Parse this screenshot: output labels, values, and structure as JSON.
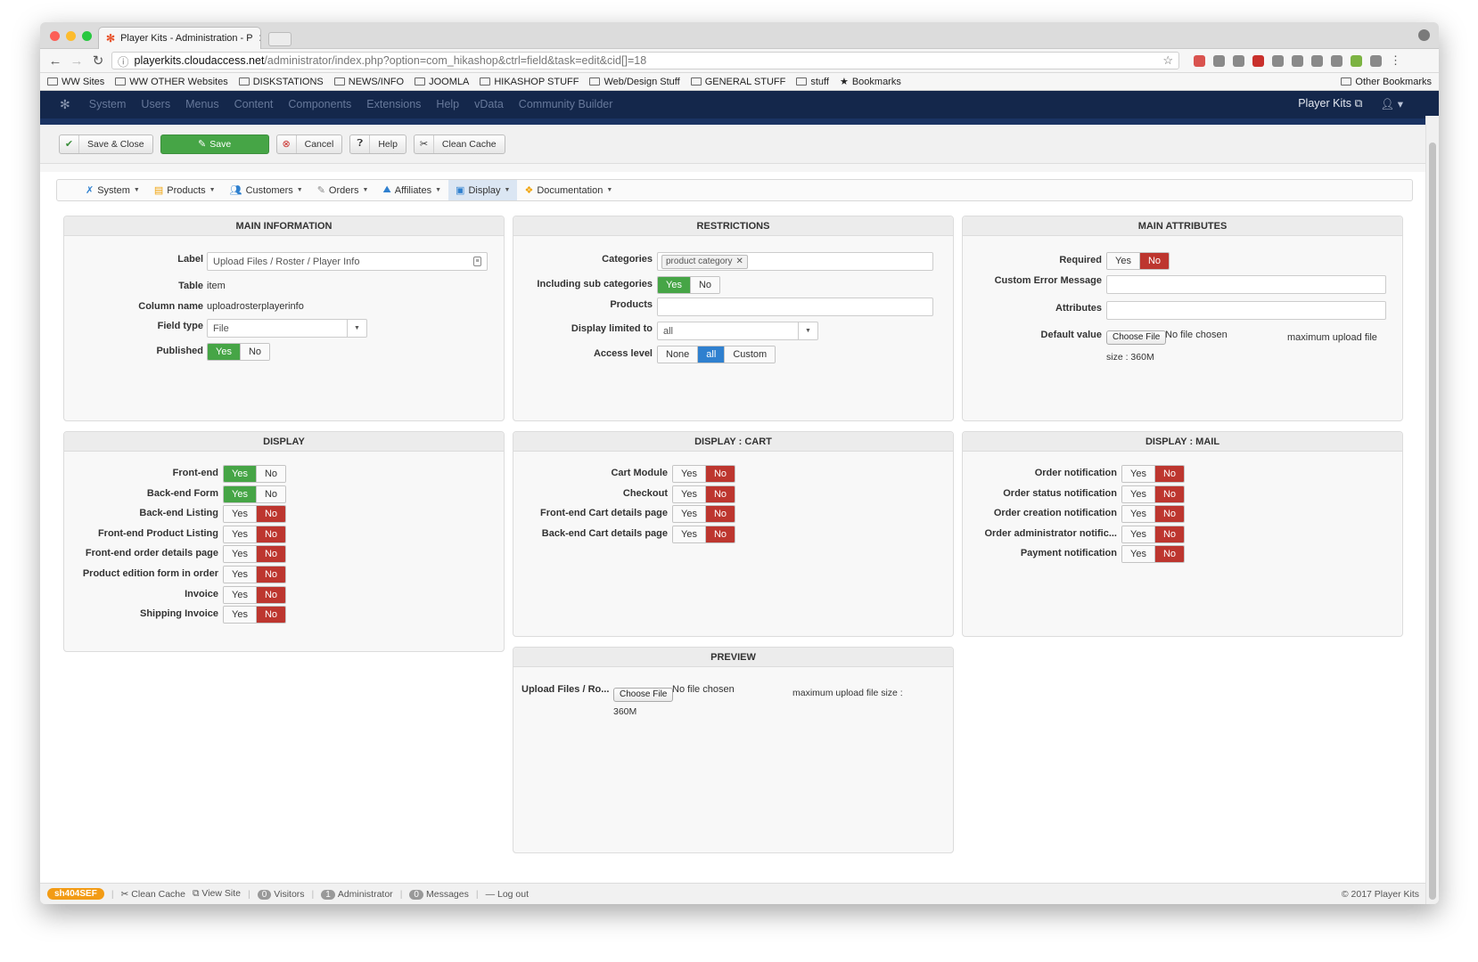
{
  "browser": {
    "tab_title": "Player Kits - Administration - P",
    "url_domain": "playerkits.cloudaccess.net",
    "url_path": "/administrator/index.php?option=com_hikashop&ctrl=field&task=edit&cid[]=18",
    "bookmarks": [
      "WW Sites",
      "WW OTHER Websites",
      "DISKSTATIONS",
      "NEWS/INFO",
      "JOOMLA",
      "HIKASHOP STUFF",
      "Web/Design Stuff",
      "GENERAL STUFF",
      "stuff",
      "Bookmarks"
    ],
    "other_bookmarks": "Other Bookmarks"
  },
  "admin_menu": {
    "items": [
      "System",
      "Users",
      "Menus",
      "Content",
      "Components",
      "Extensions",
      "Help",
      "vData",
      "Community Builder"
    ],
    "site_name": "Player Kits"
  },
  "toolbar": {
    "save_close": "Save & Close",
    "save": "Save",
    "cancel": "Cancel",
    "help": "Help",
    "clean_cache": "Clean Cache"
  },
  "hika_menu": {
    "items": [
      "System",
      "Products",
      "Customers",
      "Orders",
      "Affiliates",
      "Display",
      "Documentation"
    ]
  },
  "main_info": {
    "title": "MAIN INFORMATION",
    "label_lbl": "Label",
    "label_val": "Upload Files / Roster / Player Info",
    "table_lbl": "Table",
    "table_val": "item",
    "column_lbl": "Column name",
    "column_val": "uploadrosterplayerinfo",
    "fieldtype_lbl": "Field type",
    "fieldtype_val": "File",
    "published_lbl": "Published"
  },
  "restrictions": {
    "title": "RESTRICTIONS",
    "categories_lbl": "Categories",
    "category_tag": "product category",
    "subcat_lbl": "Including sub categories",
    "products_lbl": "Products",
    "limited_lbl": "Display limited to",
    "limited_val": "all",
    "access_lbl": "Access level",
    "access_opts": [
      "None",
      "all",
      "Custom"
    ]
  },
  "main_attrs": {
    "title": "MAIN ATTRIBUTES",
    "required_lbl": "Required",
    "error_lbl": "Custom Error Message",
    "attributes_lbl": "Attributes",
    "default_lbl": "Default value",
    "choose_file": "Choose File",
    "no_file": "No file chosen",
    "max_size_1": "maximum upload file",
    "max_size_2": "size : 360M"
  },
  "display": {
    "title": "DISPLAY",
    "rows": [
      {
        "label": "Front-end",
        "on": "yes"
      },
      {
        "label": "Back-end Form",
        "on": "yes"
      },
      {
        "label": "Back-end Listing",
        "on": "no"
      },
      {
        "label": "Front-end Product Listing",
        "on": "no"
      },
      {
        "label": "Front-end order details page",
        "on": "no"
      },
      {
        "label": "Product edition form in order",
        "on": "no"
      },
      {
        "label": "Invoice",
        "on": "no"
      },
      {
        "label": "Shipping Invoice",
        "on": "no"
      }
    ]
  },
  "display_cart": {
    "title": "DISPLAY : CART",
    "rows": [
      "Cart Module",
      "Checkout",
      "Front-end Cart details page",
      "Back-end Cart details page"
    ]
  },
  "display_mail": {
    "title": "DISPLAY : MAIL",
    "rows": [
      "Order notification",
      "Order status notification",
      "Order creation notification",
      "Order administrator notific...",
      "Payment notification"
    ]
  },
  "preview": {
    "title": "PREVIEW",
    "label": "Upload Files / Ro...",
    "choose_file": "Choose File",
    "no_file": "No file chosen",
    "max_size_1": "maximum upload file size :",
    "max_size_2": "360M"
  },
  "toggle": {
    "yes": "Yes",
    "no": "No"
  },
  "footer": {
    "sef": "sh404SEF",
    "clean_cache": "Clean Cache",
    "view_site": "View Site",
    "visitors_count": "0",
    "visitors": "Visitors",
    "admin_count": "1",
    "admin": "Administrator",
    "messages_count": "0",
    "messages": "Messages",
    "logout": "Log out",
    "copyright": "© 2017 Player Kits"
  }
}
